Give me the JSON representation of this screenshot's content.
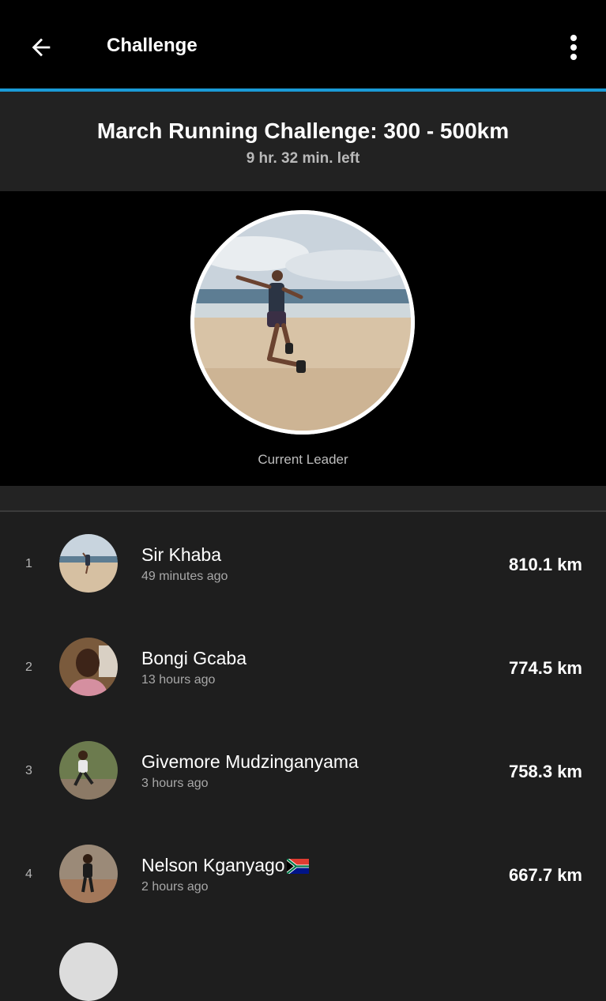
{
  "appbar": {
    "title": "Challenge",
    "back_icon": "arrow-left-icon",
    "menu_icon": "more-vertical-icon"
  },
  "challenge": {
    "title": "March Running Challenge: 300 - 500km",
    "time_left": "9 hr. 32 min. left"
  },
  "leader": {
    "label": "Current Leader"
  },
  "leaderboard": [
    {
      "rank": "1",
      "name": "Sir Khaba",
      "time": "49 minutes ago",
      "distance": "810.1 km"
    },
    {
      "rank": "2",
      "name": "Bongi Gcaba",
      "time": "13 hours ago",
      "distance": "774.5 km"
    },
    {
      "rank": "3",
      "name": "Givemore Mudzinganyama",
      "time": "3 hours ago",
      "distance": "758.3 km"
    },
    {
      "rank": "4",
      "name": "Nelson Kganyago",
      "time": "2 hours ago",
      "distance": "667.7 km"
    }
  ],
  "colors": {
    "accent": "#1a9bd7",
    "appbar_bg": "#000000",
    "list_bg": "#1e1e1e"
  }
}
